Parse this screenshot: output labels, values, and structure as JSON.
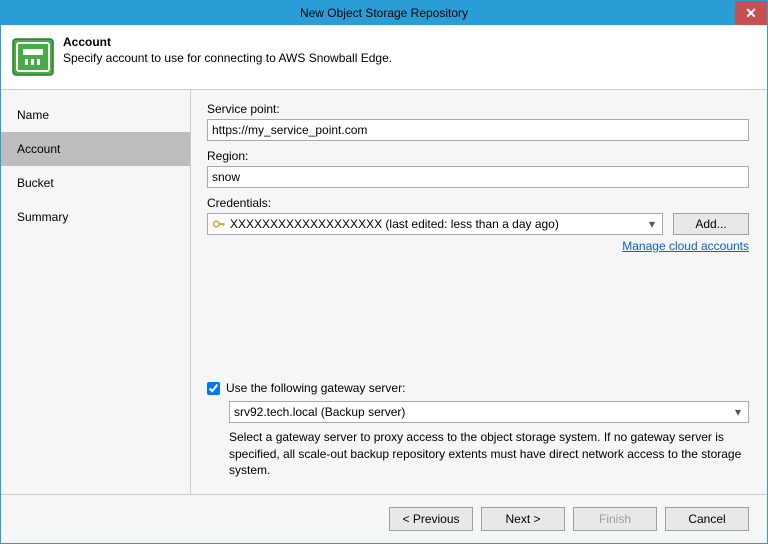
{
  "window": {
    "title": "New Object Storage Repository",
    "close": "✕"
  },
  "header": {
    "title": "Account",
    "subtitle": "Specify account to use for connecting to AWS Snowball Edge."
  },
  "sidebar": {
    "items": [
      {
        "label": "Name"
      },
      {
        "label": "Account"
      },
      {
        "label": "Bucket"
      },
      {
        "label": "Summary"
      }
    ],
    "activeIndex": 1
  },
  "form": {
    "service_point_label": "Service point:",
    "service_point_value": "https://my_service_point.com",
    "region_label": "Region:",
    "region_value": "snow",
    "credentials_label": "Credentials:",
    "credentials_value": "XXXXXXXXXXXXXXXXXXX (last edited: less than a day ago)",
    "add_button": "Add...",
    "manage_link": "Manage cloud accounts"
  },
  "gateway": {
    "checkbox_label": "Use the following gateway server:",
    "checked": true,
    "server_value": "srv92.tech.local (Backup server)",
    "hint": "Select a gateway server to proxy access to the object storage system. If no gateway server is specified, all scale-out backup repository extents must have direct network access to the storage system."
  },
  "footer": {
    "previous": "< Previous",
    "next": "Next >",
    "finish": "Finish",
    "cancel": "Cancel"
  },
  "colors": {
    "accent": "#2b9dd6",
    "close": "#c75050",
    "icon_green": "#4caf50"
  }
}
